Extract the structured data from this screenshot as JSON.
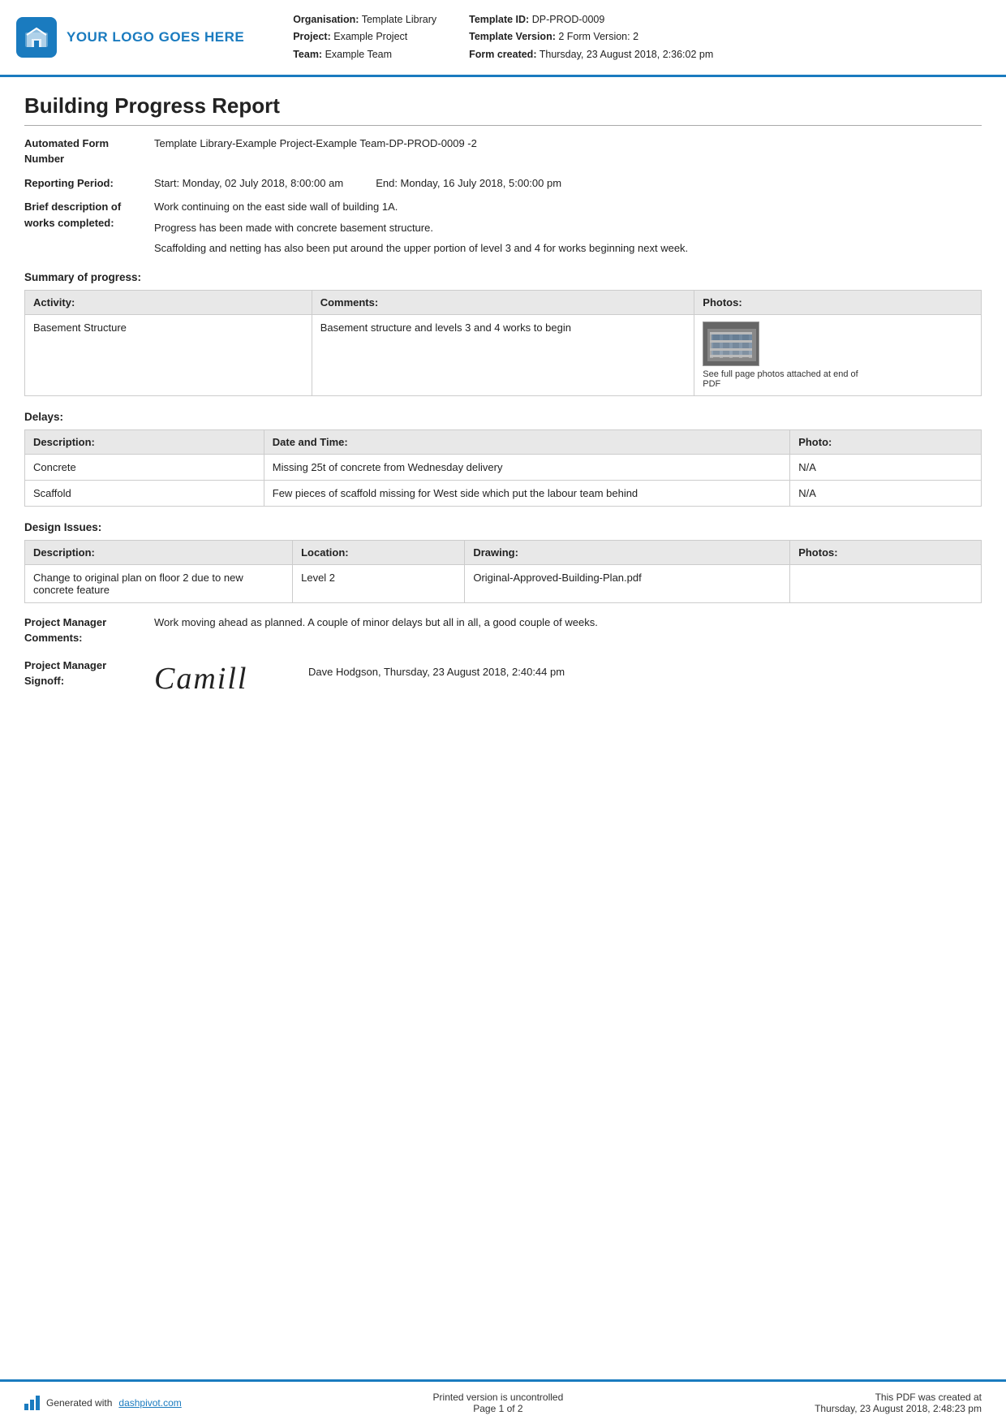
{
  "header": {
    "logo_text": "YOUR LOGO GOES HERE",
    "org_label": "Organisation:",
    "org_value": "Template Library",
    "project_label": "Project:",
    "project_value": "Example Project",
    "team_label": "Team:",
    "team_value": "Example Team",
    "template_id_label": "Template ID:",
    "template_id_value": "DP-PROD-0009",
    "template_version_label": "Template Version:",
    "template_version_value": "2",
    "form_version_label": "Form Version:",
    "form_version_value": "2",
    "form_created_label": "Form created:",
    "form_created_value": "Thursday, 23 August 2018, 2:36:02 pm"
  },
  "report": {
    "title": "Building Progress Report",
    "automated_form_number_label": "Automated Form Number",
    "automated_form_number_value": "Template Library-Example Project-Example Team-DP-PROD-0009   -2",
    "reporting_period_label": "Reporting Period:",
    "reporting_period_start": "Start: Monday, 02 July 2018, 8:00:00 am",
    "reporting_period_end": "End: Monday, 16 July 2018, 5:00:00 pm",
    "brief_description_label": "Brief description of works completed:",
    "brief_description_lines": [
      "Work continuing on the east side wall of building 1A.",
      "Progress has been made with concrete basement structure.",
      "Scaffolding and netting has also been put around the upper portion of level 3 and 4 for works beginning next week."
    ]
  },
  "summary_of_progress": {
    "section_title": "Summary of progress:",
    "table_headers": [
      "Activity:",
      "Comments:",
      "Photos:"
    ],
    "rows": [
      {
        "activity": "Basement Structure",
        "comments": "Basement structure and levels 3 and 4 works to begin",
        "photo_caption": "See full page photos attached at end of PDF"
      }
    ]
  },
  "delays": {
    "section_title": "Delays:",
    "table_headers": [
      "Description:",
      "Date and Time:",
      "Photo:"
    ],
    "rows": [
      {
        "description": "Concrete",
        "date_time": "Missing 25t of concrete from Wednesday delivery",
        "photo": "N/A"
      },
      {
        "description": "Scaffold",
        "date_time": "Few pieces of scaffold missing for West side which put the labour team behind",
        "photo": "N/A"
      }
    ]
  },
  "design_issues": {
    "section_title": "Design Issues:",
    "table_headers": [
      "Description:",
      "Location:",
      "Drawing:",
      "Photos:"
    ],
    "rows": [
      {
        "description": "Change to original plan on floor 2 due to new concrete feature",
        "location": "Level 2",
        "drawing": "Original-Approved-Building-Plan.pdf",
        "photos": ""
      }
    ]
  },
  "project_manager_comments": {
    "label": "Project Manager Comments:",
    "value": "Work moving ahead as planned. A couple of minor delays but all in all, a good couple of weeks."
  },
  "project_manager_signoff": {
    "label": "Project Manager Signoff:",
    "signature_text": "Camill",
    "signoff_details": "Dave Hodgson, Thursday, 23 August 2018, 2:40:44 pm"
  },
  "footer": {
    "generated_text": "Generated with",
    "generated_link": "dashpivot.com",
    "printed_text": "Printed version is uncontrolled",
    "page_text": "Page 1 of 2",
    "pdf_created_text": "This PDF was created at",
    "pdf_created_date": "Thursday, 23 August 2018, 2:48:23 pm"
  }
}
